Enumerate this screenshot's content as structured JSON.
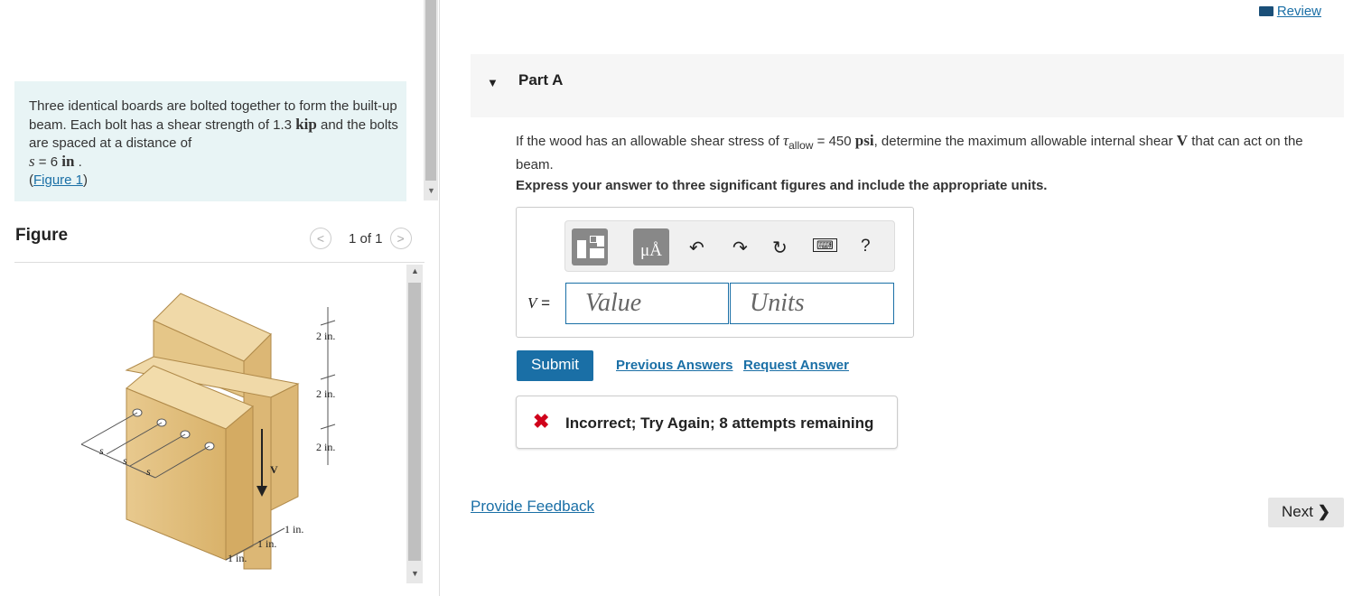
{
  "problem": {
    "text1": "Three identical boards are bolted together to form the built-up beam. Each bolt has a shear strength of 1.3",
    "unit_kip": "kip",
    "text2": "and the bolts are spaced at a distance of",
    "s_label": "s",
    "s_eq": "= 6",
    "unit_in": "in",
    "text3": ".",
    "figure_link": "Figure 1"
  },
  "figure": {
    "title": "Figure",
    "pager": "1 of 1",
    "labels": [
      "2 in.",
      "2 in.",
      "2 in.",
      "1 in.",
      "1 in.",
      "1 in.",
      "V",
      "s",
      "s",
      "s"
    ]
  },
  "header": {
    "review": "Review"
  },
  "part": {
    "label": "Part A",
    "question_a": "If the wood has an allowable shear stress of",
    "tau": "τ",
    "tau_sub": "allow",
    "question_b": "= 450",
    "psi": "psi",
    "question_c": ", determine the maximum allowable internal shear",
    "V": "V",
    "question_d": "that can act on the beam.",
    "instruction": "Express your answer to three significant figures and include the appropriate units."
  },
  "answer": {
    "variable": "V",
    "equals": "=",
    "value_placeholder": "Value",
    "units_placeholder": "Units",
    "toolbar_unit_glyph": "μÅ",
    "help": "?"
  },
  "actions": {
    "submit": "Submit",
    "previous": "Previous Answers",
    "request": "Request Answer"
  },
  "feedback": {
    "message": "Incorrect; Try Again; 8 attempts remaining"
  },
  "footer": {
    "provide_feedback": "Provide Feedback",
    "next": "Next"
  },
  "colors": {
    "link": "#1a6fa6",
    "error": "#d0021b",
    "problem_bg": "#e8f4f5"
  }
}
